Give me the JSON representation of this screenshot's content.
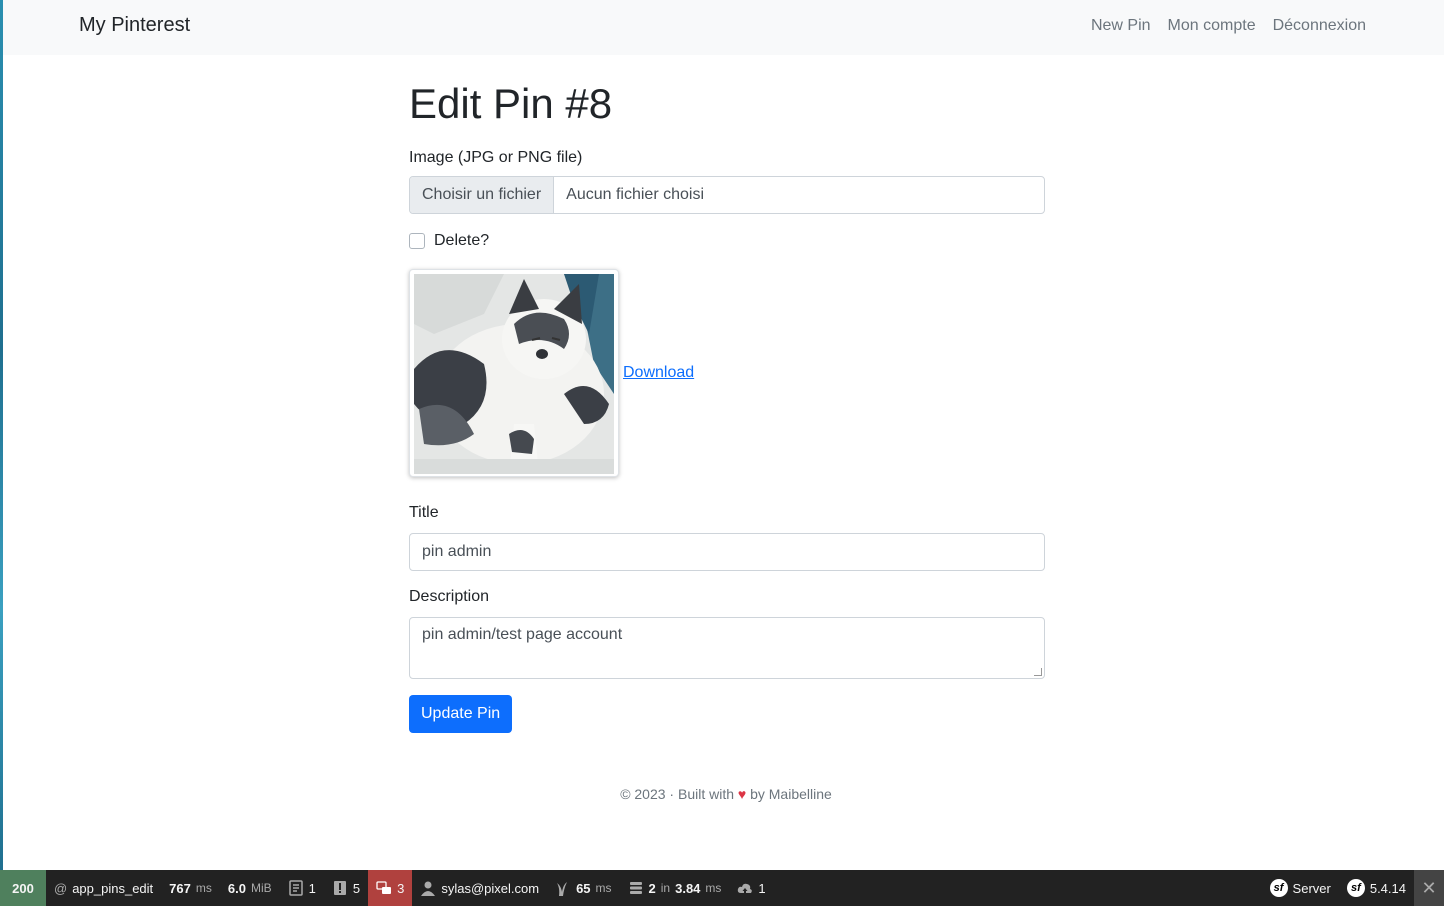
{
  "nav": {
    "brand": "My Pinterest",
    "links": [
      "New Pin",
      "Mon compte",
      "Déconnexion"
    ]
  },
  "page": {
    "title": "Edit Pin #8"
  },
  "form": {
    "image_label": "Image (JPG or PNG file)",
    "file_button": "Choisir un fichier",
    "file_value": "Aucun fichier choisi",
    "delete_label": "Delete?",
    "delete_checked": false,
    "download_label": " Download",
    "title_label": "Title",
    "title_value": "pin admin",
    "description_label": "Description",
    "description_value": "pin admin/test page account",
    "submit_label": "Update Pin"
  },
  "footer": {
    "prefix": "© 2023 · Built with",
    "heart": "♥",
    "suffix": "by Maibelline"
  },
  "toolbar": {
    "status": "200",
    "route_at": "@",
    "route": "app_pins_edit",
    "time_value": "767",
    "time_unit": "ms",
    "memory_value": "6.0",
    "memory_unit": "MiB",
    "forms_count": "1",
    "logs_count": "5",
    "translations_count": "3",
    "user": "sylas@pixel.com",
    "twig_value": "65",
    "twig_unit": "ms",
    "db_queries": "2",
    "db_in": "in",
    "db_time": "3.84",
    "db_unit": "ms",
    "http_count": "1",
    "server_label": "Server",
    "version": "5.4.14",
    "sf_glyph": "sf"
  },
  "colors": {
    "primary": "#0d6efd",
    "toolbar_bg": "#222222",
    "status_ok": "#4f805d",
    "status_error": "#b0413e"
  }
}
